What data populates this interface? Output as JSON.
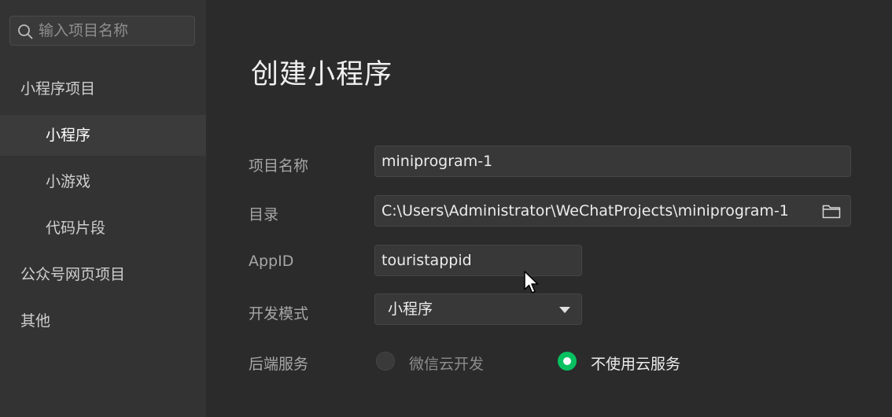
{
  "sidebar": {
    "search_placeholder": "输入项目名称",
    "items": [
      {
        "label": "小程序项目",
        "level": "group",
        "active": false
      },
      {
        "label": "小程序",
        "level": "sub",
        "active": true
      },
      {
        "label": "小游戏",
        "level": "sub",
        "active": false
      },
      {
        "label": "代码片段",
        "level": "sub",
        "active": false
      },
      {
        "label": "公众号网页项目",
        "level": "group",
        "active": false
      },
      {
        "label": "其他",
        "level": "group",
        "active": false
      }
    ]
  },
  "main": {
    "title": "创建小程序",
    "form": {
      "project_name": {
        "label": "项目名称",
        "value": "miniprogram-1"
      },
      "directory": {
        "label": "目录",
        "value": "C:\\Users\\Administrator\\WeChatProjects\\miniprogram-1"
      },
      "appid": {
        "label": "AppID",
        "value": "touristappid"
      },
      "dev_mode": {
        "label": "开发模式",
        "value": "小程序"
      },
      "backend": {
        "label": "后端服务",
        "options": [
          {
            "label": "微信云开发",
            "selected": false
          },
          {
            "label": "不使用云服务",
            "selected": true
          }
        ]
      }
    }
  },
  "colors": {
    "accent": "#07c160",
    "background": "#2b2b2b",
    "sidebar": "#333333"
  }
}
